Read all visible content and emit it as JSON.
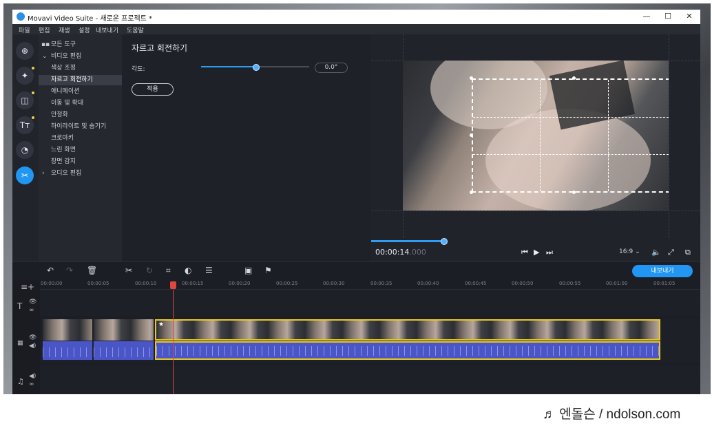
{
  "window": {
    "title": "Movavi Video Suite - 새로운 프로젝트 *",
    "controls": {
      "minimize": "—",
      "maximize": "☐",
      "close": "✕"
    }
  },
  "menu": [
    "파일",
    "편집",
    "재생",
    "설정",
    "내보내기",
    "도움말"
  ],
  "rail": {
    "icons": [
      "import-icon",
      "magic-icon",
      "filters-icon",
      "titles-icon",
      "stickers-icon",
      "tools-icon"
    ],
    "glyphs": [
      "⊕",
      "✦",
      "◫",
      "Tт",
      "◔",
      "✂"
    ]
  },
  "tools": {
    "all_tools": "모든 도구",
    "video_edit": "비디오 편집",
    "items": [
      "색상 조정",
      "자르고 회전하기",
      "애니메이션",
      "이동 및 확대",
      "안정화",
      "하이라이트 및 숨기기",
      "크로마키",
      "느린 화면",
      "장면 감지"
    ],
    "audio_edit": "오디오 편집",
    "selected_index": 1
  },
  "options": {
    "title": "자르고 회전하기",
    "angle_label": "각도:",
    "angle_value": "0.0°",
    "slider_fraction": 0.5,
    "apply_label": "적용"
  },
  "player": {
    "timecode_main": "00:00:14",
    "timecode_ms": ".000",
    "ratio": "16:9 ⌄",
    "progress_fraction": 0.22
  },
  "timeline": {
    "export_label": "내보내기",
    "ruler": [
      "00:00:00",
      "00:00:05",
      "00:00:10",
      "00:00:15",
      "00:00:20",
      "00:00:25",
      "00:00:30",
      "00:00:35",
      "00:00:40",
      "00:00:45",
      "00:00:50",
      "00:00:55",
      "00:01:00",
      "00:01:05"
    ]
  },
  "watermark": "♬ 엔돌슨 / ndolson.com",
  "colors": {
    "accent": "#2196f3",
    "selection": "#e8c824",
    "playhead": "#e2453c",
    "audio": "#4a55c8"
  }
}
